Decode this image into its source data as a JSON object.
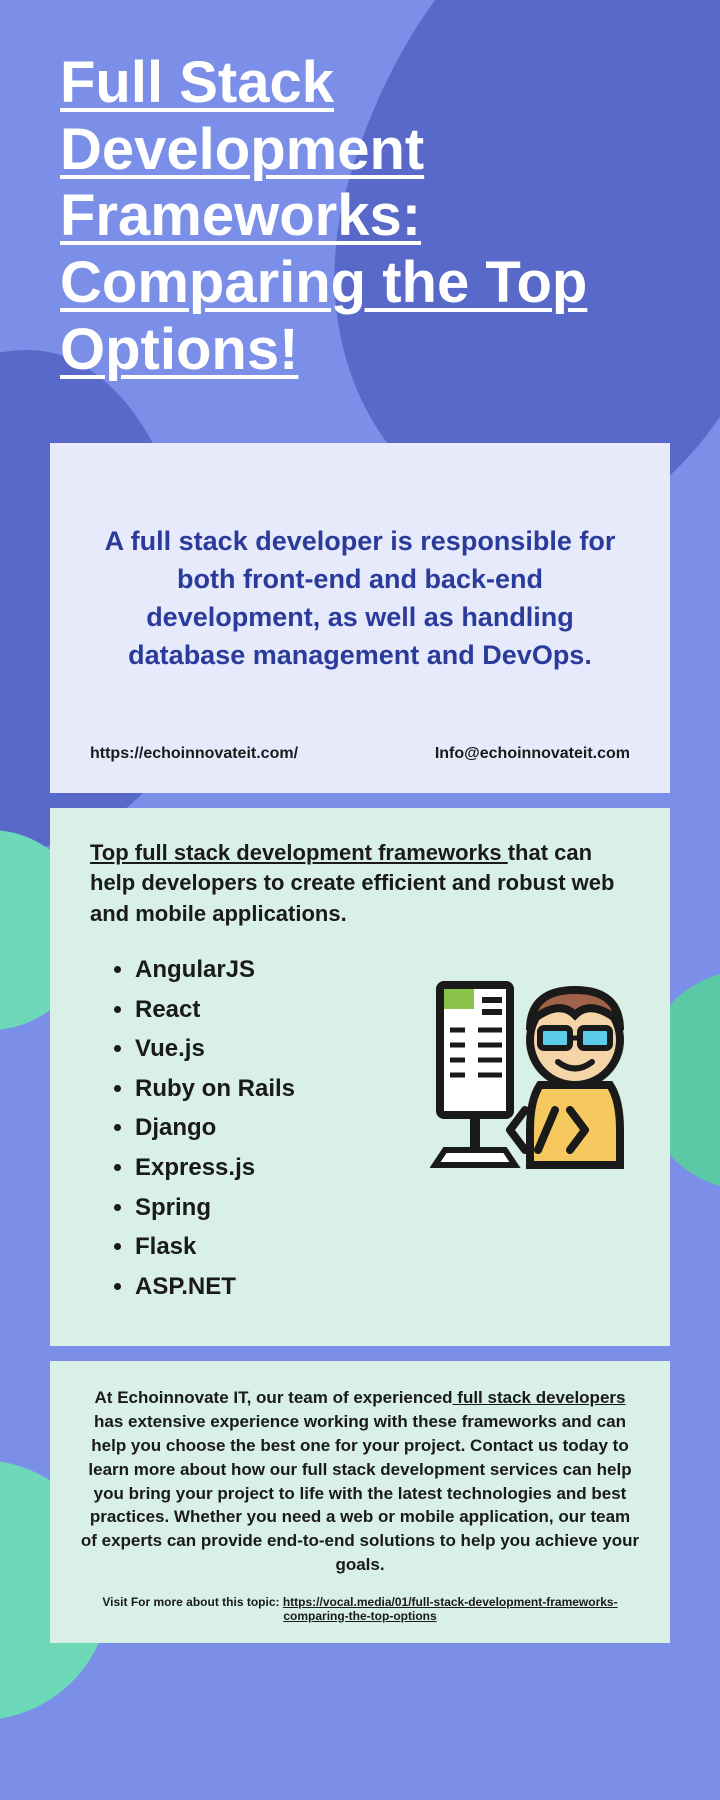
{
  "title": "Full Stack Development Frameworks: Comparing the Top Options!",
  "card1": {
    "text": "A full stack developer is responsible for both front-end and back-end development, as well as handling database management and DevOps.",
    "website": "https://echoinnovateit.com/",
    "email": "Info@echoinnovateit.com"
  },
  "card2": {
    "heading_underlined": "Top full stack development frameworks ",
    "heading_rest": "that can help developers to create efficient and robust web and mobile applications.",
    "frameworks": [
      "AngularJS",
      "React",
      "Vue.js",
      "Ruby on Rails",
      "Django",
      "Express.js",
      "Spring",
      "Flask",
      "ASP.NET"
    ]
  },
  "card3": {
    "pre": "At Echoinnovate IT, our team of experienced",
    "link": " full stack developers ",
    "post": "has extensive experience working with these frameworks and can help you choose the best one for your project. Contact us today to learn more about how our full stack development services can help you bring your project to life with the latest technologies and best practices. Whether you need a web or mobile application, our team of experts can provide end-to-end solutions to help you achieve your goals.",
    "footer_label": "Visit For more about this topic: ",
    "footer_link": "https://vocal.media/01/full-stack-development-frameworks-comparing-the-top-options"
  }
}
